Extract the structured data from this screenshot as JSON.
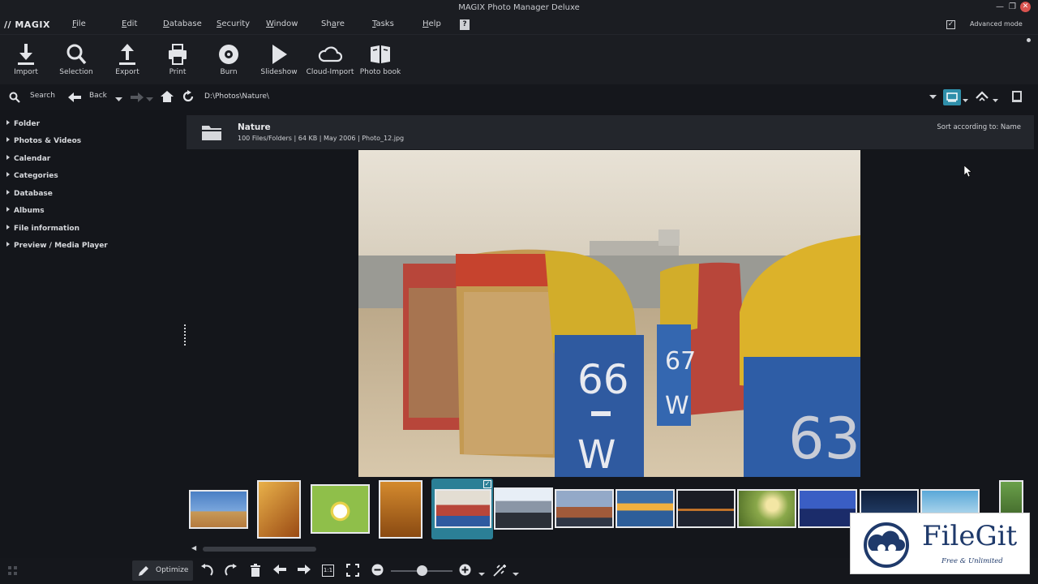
{
  "window": {
    "title": "MAGIX Photo Manager Deluxe",
    "logo": "// MAGIX",
    "controls": {
      "minimize": "—",
      "restore": "❐",
      "close": "✕"
    }
  },
  "menu": {
    "items": [
      {
        "label": "File",
        "underline": "F",
        "rest": "ile"
      },
      {
        "label": "Edit",
        "underline": "E",
        "rest": "dit"
      },
      {
        "label": "Database",
        "underline": "D",
        "rest": "atabase"
      },
      {
        "label": "Security",
        "underline": "S",
        "rest": "ecurity"
      },
      {
        "label": "Window",
        "underline": "W",
        "rest": "indow"
      },
      {
        "label": "Share",
        "pre": "Sh",
        "underline": "a",
        "rest": "re"
      },
      {
        "label": "Tasks",
        "underline": "T",
        "rest": "asks"
      },
      {
        "label": "Help",
        "underline": "H",
        "rest": "elp"
      }
    ],
    "advanced_mode_label": "Advanced mode",
    "advanced_mode_checked": "✓"
  },
  "toolbar": {
    "items": [
      {
        "label": "Import",
        "icon": "import-icon"
      },
      {
        "label": "Selection",
        "icon": "search-icon"
      },
      {
        "label": "Export",
        "icon": "export-icon"
      },
      {
        "label": "Print",
        "icon": "printer-icon"
      },
      {
        "label": "Burn",
        "icon": "disc-icon"
      },
      {
        "label": "Slideshow",
        "icon": "play-icon"
      },
      {
        "label": "Cloud-Import",
        "icon": "cloud-icon"
      },
      {
        "label": "Photo book",
        "icon": "book-icon"
      }
    ]
  },
  "nav": {
    "search_label": "Search",
    "back_label": "Back",
    "path": "D:\\Photos\\Nature\\"
  },
  "sidebar": {
    "items": [
      {
        "label": "Folder"
      },
      {
        "label": "Photos & Videos"
      },
      {
        "label": "Calendar"
      },
      {
        "label": "Categories"
      },
      {
        "label": "Database"
      },
      {
        "label": "Albums"
      },
      {
        "label": "File information"
      },
      {
        "label": "Preview / Media Player"
      }
    ]
  },
  "folder": {
    "name": "Nature",
    "meta": "100 Files/Folders | 64 KB | May 2006 | Photo_12.jpg",
    "sort_label": "Sort according to: Name"
  },
  "preview": {
    "chair_numbers": [
      "66",
      "W",
      "67",
      "W",
      "63"
    ]
  },
  "filmstrip": {
    "selected_index": 4,
    "selected_check": "✓"
  },
  "bottom": {
    "optimize_label": "Optimize",
    "one_to_one": "1:1"
  },
  "watermark": {
    "title": "FileGit",
    "subtitle": "Free & Unlimited"
  },
  "colors": {
    "accent": "#2f8faa",
    "background": "#14161b",
    "panel": "#1b1d22"
  }
}
